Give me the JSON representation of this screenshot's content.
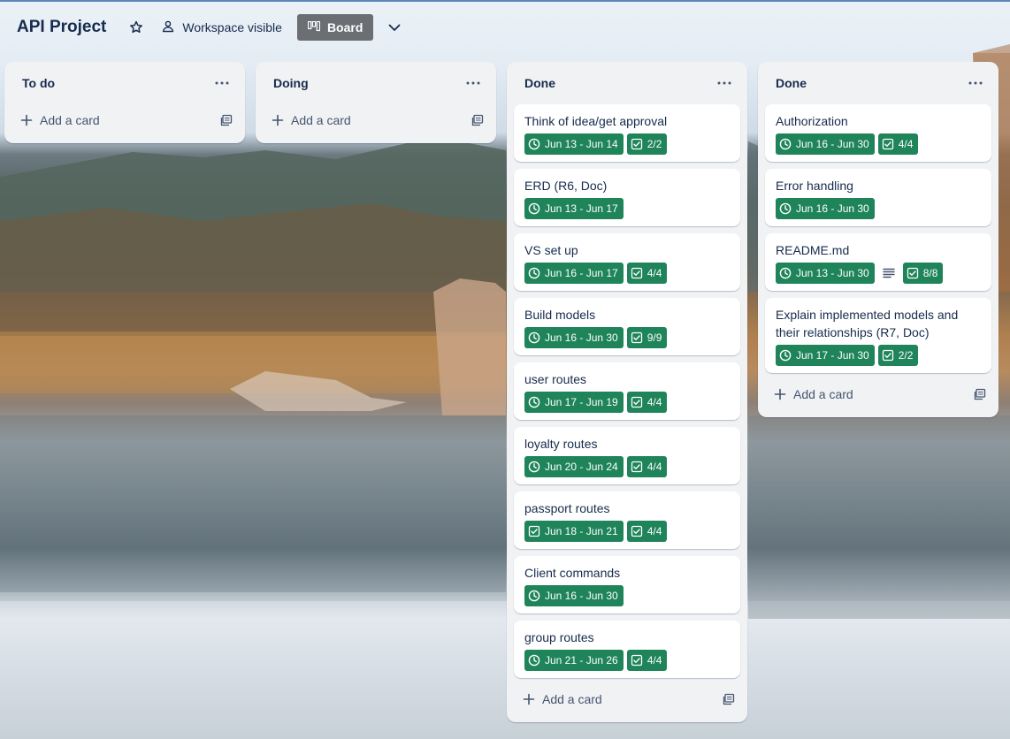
{
  "board": {
    "title": "API Project",
    "visibility": "Workspace visible",
    "view": "Board"
  },
  "icons": {
    "star": "star-icon",
    "visibility": "workspace-people-icon",
    "board_view": "board-columns-icon",
    "chevron": "chevron-down-icon",
    "menu": "more-horizontal-icon",
    "add": "plus-icon",
    "template": "card-template-icon",
    "clock": "clock-icon",
    "checklist": "checklist-icon",
    "checkbox_date": "checkbox-icon",
    "description": "description-lines-icon"
  },
  "colors": {
    "badge_green": "#1f845a",
    "board_btn": "#6b6f73",
    "list_bg": "#f1f2f4"
  },
  "add_card_label": "Add a card",
  "lists": [
    {
      "title": "To do",
      "cards": []
    },
    {
      "title": "Doing",
      "cards": []
    },
    {
      "title": "Done",
      "cards": [
        {
          "title": "Think of idea/get approval",
          "date": "Jun 13 - Jun 14",
          "date_icon": "clock",
          "checklist": "2/2"
        },
        {
          "title": "ERD (R6, Doc)",
          "date": "Jun 13 - Jun 17",
          "date_icon": "clock"
        },
        {
          "title": "VS set up",
          "date": "Jun 16 - Jun 17",
          "date_icon": "clock",
          "checklist": "4/4"
        },
        {
          "title": "Build models",
          "date": "Jun 16 - Jun 30",
          "date_icon": "clock",
          "checklist": "9/9"
        },
        {
          "title": "user routes",
          "date": "Jun 17 - Jun 19",
          "date_icon": "clock",
          "checklist": "4/4"
        },
        {
          "title": "loyalty routes",
          "date": "Jun 20 - Jun 24",
          "date_icon": "clock",
          "checklist": "4/4"
        },
        {
          "title": "passport routes",
          "date": "Jun 18 - Jun 21",
          "date_icon": "checkbox",
          "checklist": "4/4"
        },
        {
          "title": "Client commands",
          "date": "Jun 16 - Jun 30",
          "date_icon": "clock"
        },
        {
          "title": "group routes",
          "date": "Jun 21 - Jun 26",
          "date_icon": "clock",
          "checklist": "4/4"
        }
      ]
    },
    {
      "title": "Done",
      "cards": [
        {
          "title": "Authorization",
          "date": "Jun 16 - Jun 30",
          "date_icon": "clock",
          "checklist": "4/4"
        },
        {
          "title": "Error handling",
          "date": "Jun 16 - Jun 30",
          "date_icon": "clock"
        },
        {
          "title": "README.md",
          "date": "Jun 13 - Jun 30",
          "date_icon": "clock",
          "description": true,
          "checklist": "8/8"
        },
        {
          "title": "Explain implemented models and their relationships (R7, Doc)",
          "date": "Jun 17 - Jun 30",
          "date_icon": "clock",
          "checklist": "2/2"
        }
      ]
    }
  ]
}
